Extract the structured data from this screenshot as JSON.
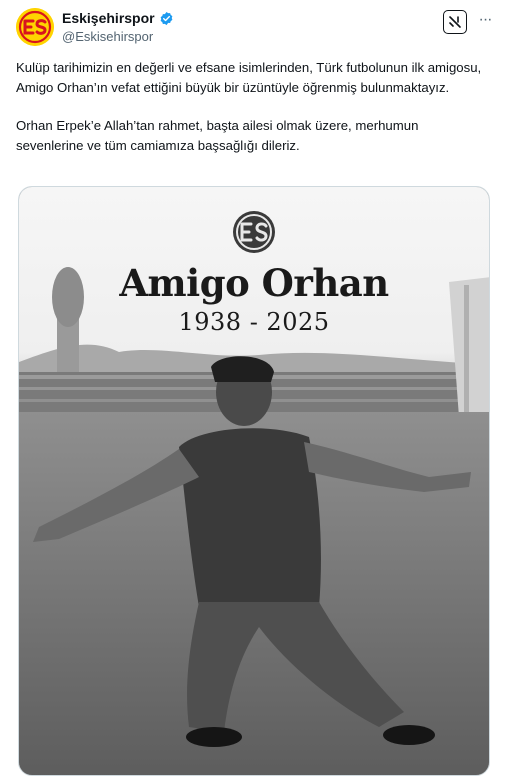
{
  "author": {
    "display_name": "Eskişehirspor",
    "handle": "@Eskisehirspor",
    "avatar_icon": "eskisehirspor-logo",
    "verified_icon": "verified-badge-icon",
    "brand_colors": {
      "red": "#d8141e",
      "yellow": "#ffd400",
      "verified_blue": "#1d9bf0"
    }
  },
  "actions": {
    "grok_icon": "grok-icon",
    "more_icon": "more-options-icon",
    "more_label": "···"
  },
  "tweet": {
    "paragraphs": [
      "Kulüp tarihimizin en değerli ve efsane isimlerinden, Türk futbolunun ilk amigosu, Amigo Orhan’ın vefat ettiğini büyük bir üzüntüyle öğrenmiş bulunmaktayız.",
      "Orhan Erpek’e Allah’tan rahmet, başta ailesi olmak üzere, merhumun sevenlerine ve tüm camiamıza başsağlığı dileriz."
    ]
  },
  "media": {
    "logo_text": "ES",
    "name": "Amigo Orhan",
    "years": "1938 - 2025",
    "photo_description_icon": "memorial-photo"
  }
}
